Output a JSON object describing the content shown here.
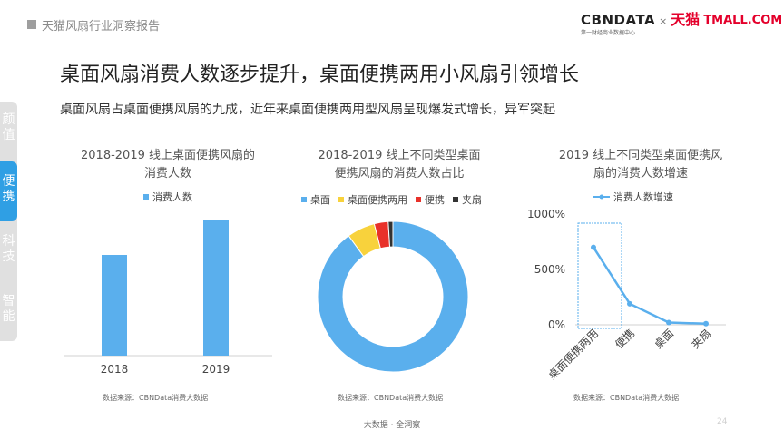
{
  "header": {
    "title": "天猫风扇行业洞察报告"
  },
  "logo": {
    "cbn": "CBNDATA",
    "cbn_sub": "第一财经商业数据中心",
    "times": "×",
    "tmall_cn": "天猫",
    "tmall_en": "TMALL.COM"
  },
  "page_title": "桌面风扇消费人数逐步提升，桌面便携两用小风扇引领增长",
  "subtitle": "桌面风扇占桌面便携风扇的九成，近年来桌面便携两用型风扇呈现爆发式增长，异军突起",
  "sidenav": {
    "items": [
      "颜值",
      "便携",
      "科技",
      "智能"
    ],
    "active": "便携"
  },
  "colors": {
    "accent": "#2f9fe4",
    "bar": "#5aafed",
    "desk": "#5aafed",
    "dual": "#f8d23c",
    "portable": "#e8312a",
    "clip": "#333333"
  },
  "charts": {
    "bar": {
      "title_line1": "2018-2019 线上桌面便携风扇的",
      "title_line2": "消费人数",
      "legend": "消费人数",
      "source": "数据来源：CBNData消费大数据"
    },
    "donut": {
      "title_line1": "2018-2019 线上不同类型桌面",
      "title_line2": "便携风扇的消费人数占比",
      "source": "数据来源：CBNData消费大数据"
    },
    "line": {
      "title_line1": "2019 线上不同类型桌面便携风",
      "title_line2": "扇的消费人数增速",
      "legend": "消费人数增速",
      "source": "数据来源：CBNData消费大数据"
    }
  },
  "chart_data": [
    {
      "type": "bar",
      "categories": [
        "2018",
        "2019"
      ],
      "series": [
        {
          "name": "消费人数",
          "values": [
            0.74,
            1.0
          ]
        }
      ],
      "ylim": [
        0,
        1.0
      ]
    },
    {
      "type": "pie",
      "categories": [
        "桌面",
        "桌面便携两用",
        "便携",
        "夹扇"
      ],
      "values": [
        0.9,
        0.06,
        0.03,
        0.01
      ]
    },
    {
      "type": "line",
      "categories": [
        "桌面便携两用",
        "便携",
        "桌面",
        "夹扇"
      ],
      "series": [
        {
          "name": "消费人数增速",
          "values": [
            700,
            190,
            20,
            10
          ]
        }
      ],
      "ylim": [
        0,
        1000
      ],
      "yticks": [
        "0%",
        "500%",
        "1000%"
      ]
    }
  ],
  "footer": {
    "text": "大数据 · 全洞察",
    "page": "24"
  }
}
